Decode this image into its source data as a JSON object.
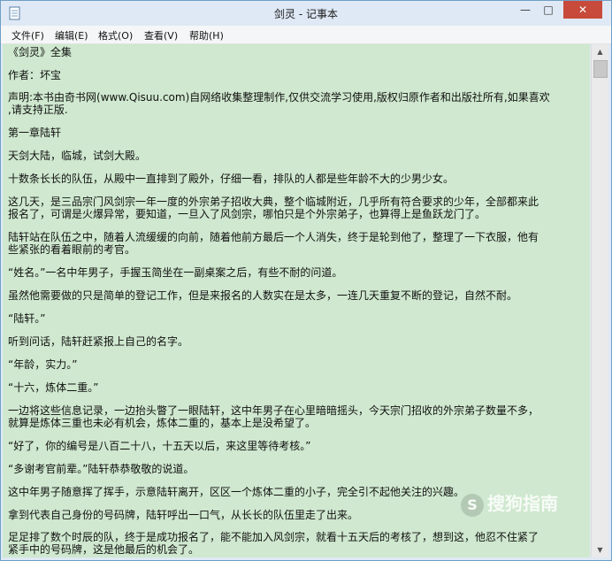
{
  "window": {
    "title": "剑灵 - 记事本"
  },
  "menu": [
    "文件(F)",
    "编辑(E)",
    "格式(O)",
    "查看(V)",
    "帮助(H)"
  ],
  "controls": {
    "minimize": "—",
    "maximize": "□",
    "close": "✕"
  },
  "lines": [
    "《剑灵》全集",
    "作者：坏宝",
    "声明:本书由奇书网(www.Qisuu.com)自网络收集整理制作,仅供交流学习使用,版权归原作者和出版社所有,如果喜欢",
    ",请支持正版.",
    "第一章陆轩",
    "天剑大陆，临城，试剑大殿。",
    "十数条长长的队伍，从殿中一直排到了殿外，仔细一看，排队的人都是些年龄不大的少男少女。",
    "这几天，是三品宗门风剑宗一年一度的外宗弟子招收大典，整个临城附近，几乎所有符合要求的少年，全部都来此",
    "报名了，可谓是火爆异常，要知道，一旦入了风剑宗，哪怕只是个外宗弟子，也算得上是鱼跃龙门了。",
    "陆轩站在队伍之中，随着人流缓缓的向前，随着他前方最后一个人消失，终于是轮到他了，整理了一下衣服，他有",
    "些紧张的看着眼前的考官。",
    "“姓名。”一名中年男子，手握玉简坐在一副桌案之后，有些不耐的问道。",
    "虽然他需要做的只是简单的登记工作，但是来报名的人数实在是太多，一连几天重复不断的登记，自然不耐。",
    "“陆轩。”",
    "听到问话，陆轩赶紧报上自己的名字。",
    "“年龄，实力。”",
    "“十六，炼体二重。”",
    "一边将这些信息记录，一边抬头瞥了一眼陆轩，这中年男子在心里暗暗摇头，今天宗门招收的外宗弟子数量不多，",
    "就算是炼体三重也未必有机会，炼体二重的，基本上是没希望了。",
    "“好了，你的编号是八百二十八，十五天以后，来这里等待考核。”",
    "“多谢考官前辈。”陆轩恭恭敬敬的说道。",
    "这中年男子随意挥了挥手，示意陆轩离开，区区一个炼体二重的小子，完全引不起他关注的兴趣。",
    "拿到代表自己身份的号码牌，陆轩呼出一口气，从长长的队伍里走了出来。",
    "足足排了数个时辰的队，终于是成功报名了，能不能加入风剑宗，就看十五天后的考核了，想到这，他忍不住紧了",
    "紧手中的号码牌，这是他最后的机会了。"
  ],
  "watermark": {
    "text": "搜狗指南",
    "icon": "S"
  }
}
